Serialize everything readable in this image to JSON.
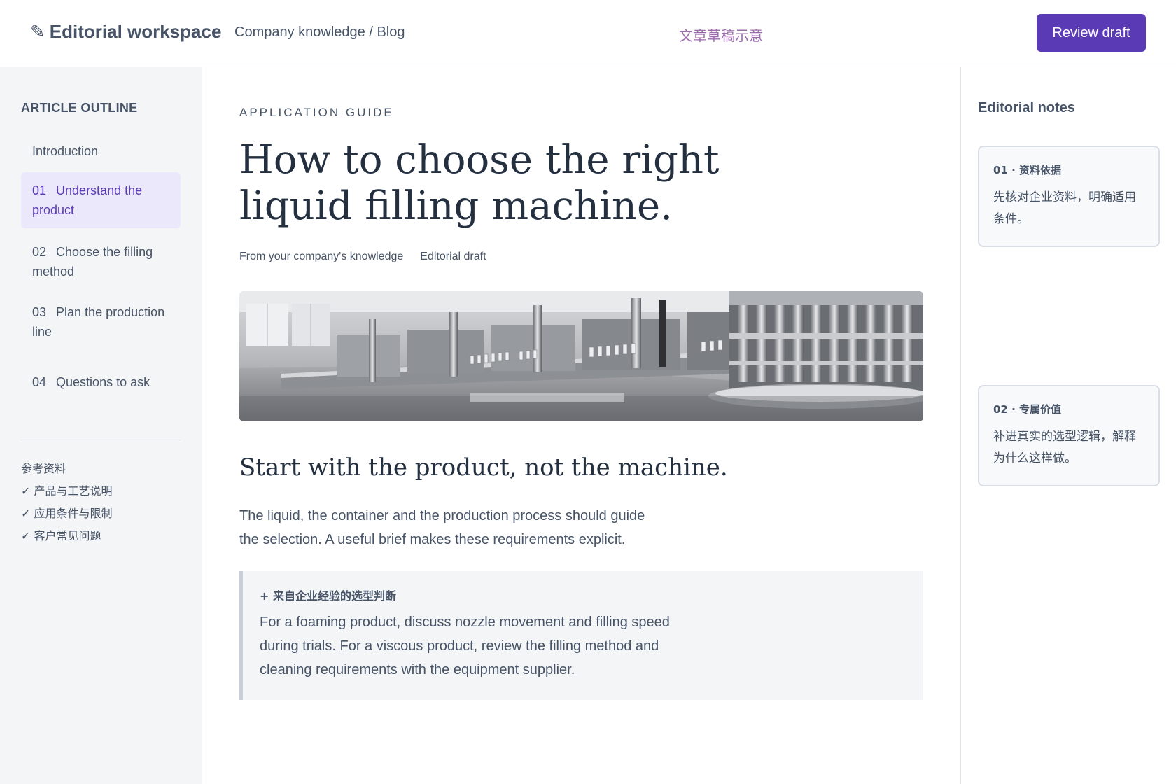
{
  "header": {
    "brand_icon": "pencil-icon",
    "brand": "Editorial workspace",
    "breadcrumb": "Company knowledge / Blog",
    "center_note": "文章草稿示意",
    "review_button": "Review draft"
  },
  "sidebar": {
    "title": "ARTICLE OUTLINE",
    "items": [
      {
        "num": "",
        "label": "Introduction",
        "active": false
      },
      {
        "num": "01",
        "label": "Understand the product",
        "active": true
      },
      {
        "num": "02",
        "label": "Choose the filling method",
        "active": false
      },
      {
        "num": "03",
        "label": "Plan the production line",
        "active": false
      },
      {
        "num": "04",
        "label": "Questions to ask",
        "active": false
      }
    ],
    "refs_title": "参考资料",
    "refs": [
      "✓ 产品与工艺说明",
      "✓ 应用条件与限制",
      "✓ 客户常见问题"
    ]
  },
  "article": {
    "eyebrow": "APPLICATION GUIDE",
    "headline": "How to choose the right liquid filling machine.",
    "meta_source": "From your company's knowledge",
    "meta_status": "Editorial draft",
    "section_title": "Start with the product, not the machine.",
    "body": "The liquid, the container and the production process should guide the selection. A useful brief makes these requirements explicit.",
    "callout_label": "+ 来自企业经验的选型判断",
    "callout_text": "For a foaming product, discuss nozzle movement and filling speed during trials. For a viscous product, review the filling method and cleaning requirements with the equipment supplier."
  },
  "notes": {
    "title": "Editorial notes",
    "cards": [
      {
        "title": "01 · 资料依据",
        "body": "先核对企业资料，明确适用条件。"
      },
      {
        "title": "02 · 专属价值",
        "body": "补进真实的选型逻辑，解释为什么这样做。"
      }
    ]
  },
  "colors": {
    "accent": "#5b3bb5",
    "active_bg": "#ece8fb",
    "sidebar_bg": "#f4f5f7",
    "note_accent": "#9b6bb0"
  }
}
